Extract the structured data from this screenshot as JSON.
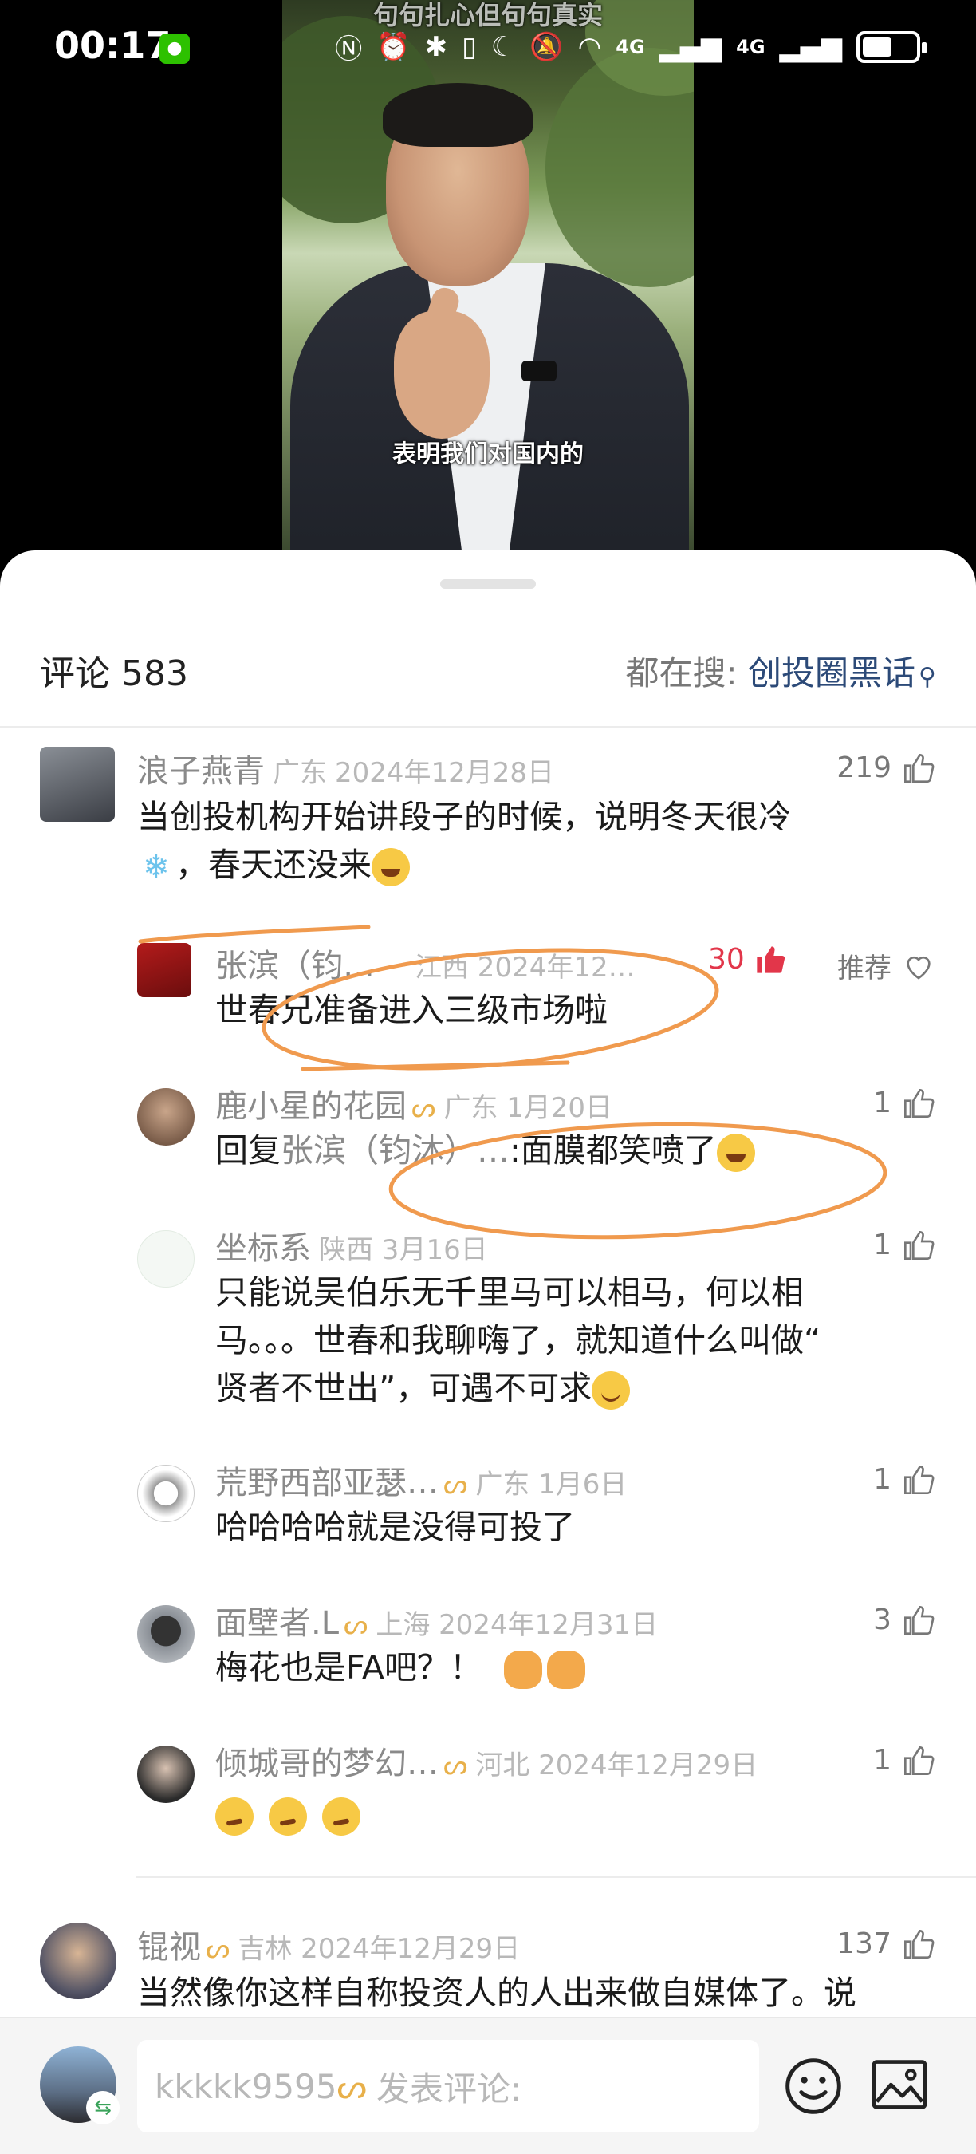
{
  "status_bar": {
    "time": "00:17",
    "network_4g_1": "4G",
    "network_4g_2": "4G"
  },
  "video": {
    "overlay_title": "句句扎心但句句真实",
    "subtitle": "表明我们对国内的"
  },
  "header": {
    "comment_label": "评论 583",
    "search_prefix": "都在搜:",
    "search_term": "创投圈黑话"
  },
  "comments": [
    {
      "name": "浪子燕青",
      "location": "广东",
      "date": "2024年12月28日",
      "likes": "219",
      "text_line1": "当创投机构开始讲段子的时候，说明冬天很冷",
      "text_line2": "，春天还没来"
    },
    {
      "name": "张滨（钧…",
      "meta": "江西 2024年12…",
      "likes": "30",
      "recommend_label": "推荐",
      "text": "世春兄准备进入三级市场啦"
    },
    {
      "name": "鹿小星的花园",
      "meta": "广东 1月20日",
      "likes": "1",
      "reply_prefix": "回复",
      "reply_target": "张滨（钧沐）…",
      "text": ":面膜都笑喷了"
    },
    {
      "name": "坐标系",
      "meta": "陕西 3月16日",
      "likes": "1",
      "text_line1": "只能说吴伯乐无千里马可以相马，何以相",
      "text_line2": "马。。。世春和我聊嗨了，就知道什么叫做“",
      "text_line3": "贤者不世出”，可遇不可求"
    },
    {
      "name": "荒野西部亚瑟…",
      "meta": "广东 1月6日",
      "likes": "1",
      "text": "哈哈哈哈就是没得可投了"
    },
    {
      "name": "面壁者.L",
      "meta": "上海 2024年12月31日",
      "likes": "3",
      "text": "梅花也是FA吧？！"
    },
    {
      "name": "倾城哥的梦幻…",
      "meta": "河北 2024年12月29日",
      "likes": "1"
    },
    {
      "name": "锟视",
      "meta": "吉林 2024年12月29日",
      "likes": "137",
      "text": "当然像你这样自称投资人的人出来做自媒体了。说"
    }
  ],
  "input_bar": {
    "username": "kkkkk9595",
    "placeholder": "发表评论:"
  },
  "icons": {
    "like": "thumbs-up-icon",
    "liked": "thumbs-up-filled-icon",
    "recommend": "heart-outline-icon",
    "fans_badge": "infinity-badge-icon",
    "emoji_button": "smiley-icon",
    "image_button": "image-icon",
    "search": "magnifier-icon"
  },
  "colors": {
    "liked_red": "#e2364a",
    "link_blue": "#2c4a78",
    "badge_gold": "#e8b04a",
    "annotation_orange": "#f09a4e"
  }
}
